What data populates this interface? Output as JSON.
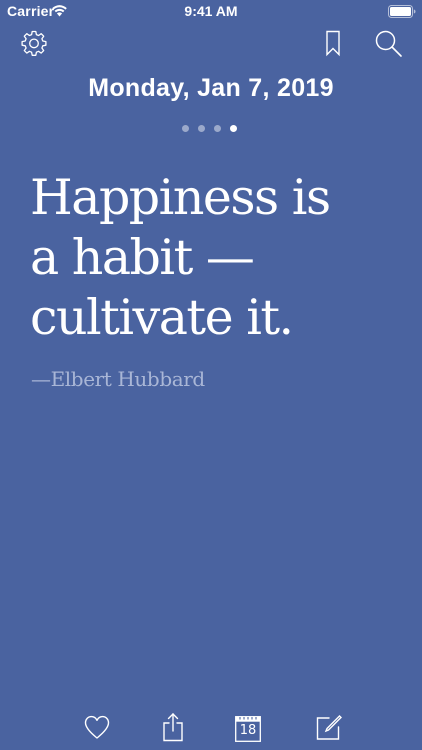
{
  "status_bar": {
    "carrier": "Carrier",
    "time": "9:41 AM"
  },
  "toolbar": {
    "settings_icon": "gear-icon",
    "bookmark_icon": "bookmark-icon",
    "search_icon": "search-icon"
  },
  "header": {
    "date": "Monday, Jan 7, 2019"
  },
  "pager": {
    "total": 4,
    "active_index": 3
  },
  "quote": {
    "lines": [
      "Happiness is",
      "a habit —",
      "cultivate it."
    ],
    "author": "—Elbert Hubbard"
  },
  "bottom_bar": {
    "like_icon": "heart-icon",
    "share_icon": "share-icon",
    "calendar_icon": "calendar-icon",
    "calendar_day": "18",
    "edit_icon": "compose-icon"
  },
  "colors": {
    "background": "#4a63a0",
    "text": "#ffffff",
    "author_text": "#a9b6d6"
  }
}
